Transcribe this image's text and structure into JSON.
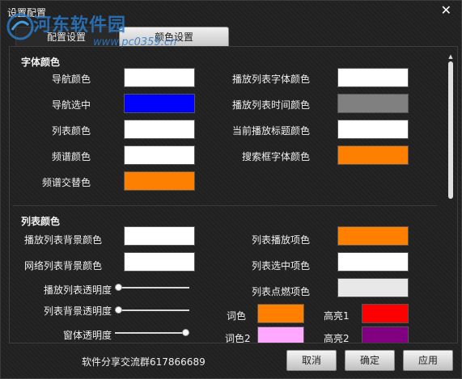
{
  "window": {
    "title": "设置配置",
    "close_glyph": "✕"
  },
  "watermark": {
    "text": "河东软件园",
    "url": "www.pc0359.cn"
  },
  "tabs": [
    {
      "label": "配置设置"
    },
    {
      "label": "颜色设置"
    }
  ],
  "font_section": {
    "title": "字体颜色",
    "left": [
      {
        "label": "导航颜色",
        "color": "#ffffff"
      },
      {
        "label": "导航选中",
        "color": "#0000ff"
      },
      {
        "label": "列表颜色",
        "color": "#ffffff"
      },
      {
        "label": "频谱颜色",
        "color": "#ffffff"
      },
      {
        "label": "频谱交替色",
        "color": "#ff8000"
      }
    ],
    "right": [
      {
        "label": "播放列表字体颜色",
        "color": "#ffffff"
      },
      {
        "label": "播放列表时间颜色",
        "color": "#808080"
      },
      {
        "label": "当前播放标题颜色",
        "color": "#ffffff"
      },
      {
        "label": "搜索框字体颜色",
        "color": "#ff8000"
      }
    ]
  },
  "list_section": {
    "title": "列表颜色",
    "left_colors": [
      {
        "label": "播放列表背景颜色",
        "color": "#ffffff"
      },
      {
        "label": "网络列表背景颜色",
        "color": "#ffffff"
      }
    ],
    "sliders": [
      {
        "label": "播放列表透明度",
        "value": 0.0
      },
      {
        "label": "列表背景透明度",
        "value": 0.0
      },
      {
        "label": "窗体透明度",
        "value": 1.0
      }
    ],
    "right": [
      {
        "label": "列表播放项色",
        "color": "#ff8000"
      },
      {
        "label": "列表选中项色",
        "color": "#ffffff"
      },
      {
        "label": "列表点燃项色",
        "color": "#e8e8e8"
      }
    ],
    "lyric": [
      {
        "label": "词色",
        "color": "#ff8000"
      },
      {
        "label": "高亮1",
        "color": "#ff0000"
      },
      {
        "label": "词色2",
        "color": "#ffa8ff"
      },
      {
        "label": "高亮2",
        "color": "#800080"
      }
    ]
  },
  "footer": {
    "text": "软件分享交流群617866689",
    "buttons": [
      "取消",
      "确定",
      "应用"
    ]
  }
}
